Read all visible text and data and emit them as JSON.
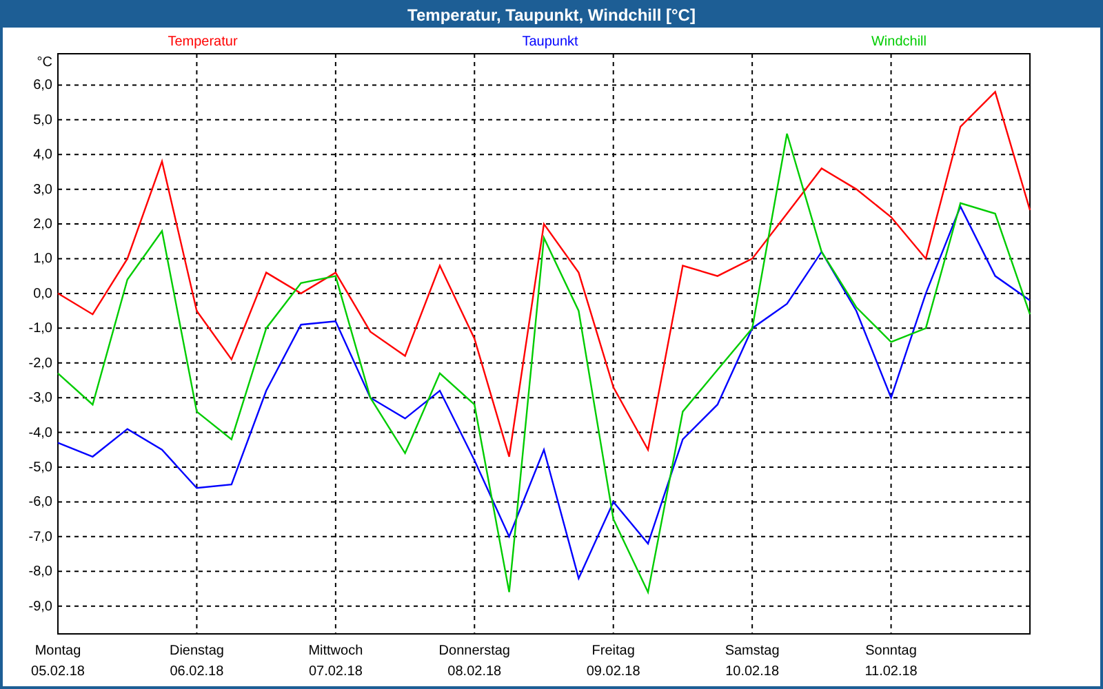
{
  "window": {
    "title": "Temperatur, Taupunkt, Windchill [°C]"
  },
  "chart_data": {
    "type": "line",
    "ylabel": "°C",
    "grid": true,
    "ylim": [
      -9.8,
      6.9
    ],
    "yticks": [
      {
        "value": 6,
        "label": "6,0"
      },
      {
        "value": 5,
        "label": "5,0"
      },
      {
        "value": 4,
        "label": "4,0"
      },
      {
        "value": 3,
        "label": "3,0"
      },
      {
        "value": 2,
        "label": "2,0"
      },
      {
        "value": 1,
        "label": "1,0"
      },
      {
        "value": 0,
        "label": "0,0"
      },
      {
        "value": -1,
        "label": "-1,0"
      },
      {
        "value": -2,
        "label": "-2,0"
      },
      {
        "value": -3,
        "label": "-3,0"
      },
      {
        "value": -4,
        "label": "-4,0"
      },
      {
        "value": -5,
        "label": "-5,0"
      },
      {
        "value": -6,
        "label": "-6,0"
      },
      {
        "value": -7,
        "label": "-7,0"
      },
      {
        "value": -8,
        "label": "-8,0"
      },
      {
        "value": -9,
        "label": "-9,0"
      }
    ],
    "categories": [
      "Montag\n05.02.18",
      null,
      null,
      null,
      "Dienstag\n06.02.18",
      null,
      null,
      null,
      "Mittwoch\n07.02.18",
      null,
      null,
      null,
      "Donnerstag\n08.02.18",
      null,
      null,
      null,
      "Freitag\n09.02.18",
      null,
      null,
      null,
      "Samstag\n10.02.18",
      null,
      null,
      null,
      "Sonntag\n11.02.18",
      null,
      null,
      null,
      null
    ],
    "series": [
      {
        "name": "Temperatur",
        "color": "#ff0000",
        "values": [
          0,
          -0.6,
          1.0,
          3.8,
          -0.5,
          -1.9,
          0.6,
          0.0,
          0.6,
          -1.1,
          -1.8,
          0.8,
          -1.3,
          -4.7,
          2.0,
          0.6,
          -2.7,
          -4.5,
          0.8,
          0.5,
          1.0,
          2.3,
          3.6,
          3.0,
          2.2,
          1.0,
          4.8,
          5.8,
          2.4
        ]
      },
      {
        "name": "Taupunkt",
        "color": "#0000ff",
        "values": [
          -4.3,
          -4.7,
          -3.9,
          -4.5,
          -5.6,
          -5.5,
          -2.8,
          -0.9,
          -0.8,
          -3.0,
          -3.6,
          -2.8,
          -4.8,
          -7.0,
          -4.5,
          -8.2,
          -6.0,
          -7.2,
          -4.2,
          -3.2,
          -1.0,
          -0.3,
          1.2,
          -0.5,
          -3.0,
          0.0,
          2.5,
          0.5,
          -0.2
        ]
      },
      {
        "name": "Windchill",
        "color": "#00cc00",
        "values": [
          -2.3,
          -3.2,
          0.4,
          1.8,
          -3.4,
          -4.2,
          -1.0,
          0.3,
          0.5,
          -3.0,
          -4.6,
          -2.3,
          -3.2,
          -8.6,
          1.6,
          -0.5,
          -6.5,
          -8.6,
          -3.4,
          -2.2,
          -1.0,
          4.6,
          1.2,
          -0.4,
          -1.4,
          -1.0,
          2.6,
          2.3,
          -0.6
        ]
      }
    ]
  }
}
